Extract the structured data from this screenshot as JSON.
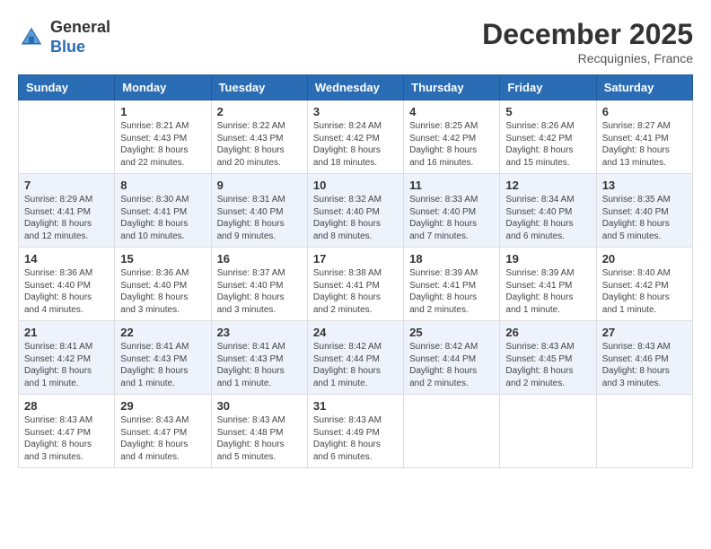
{
  "header": {
    "logo_general": "General",
    "logo_blue": "Blue",
    "month_title": "December 2025",
    "location": "Recquignies, France"
  },
  "calendar": {
    "days_of_week": [
      "Sunday",
      "Monday",
      "Tuesday",
      "Wednesday",
      "Thursday",
      "Friday",
      "Saturday"
    ],
    "weeks": [
      [
        {
          "day": "",
          "content": ""
        },
        {
          "day": "1",
          "content": "Sunrise: 8:21 AM\nSunset: 4:43 PM\nDaylight: 8 hours\nand 22 minutes."
        },
        {
          "day": "2",
          "content": "Sunrise: 8:22 AM\nSunset: 4:43 PM\nDaylight: 8 hours\nand 20 minutes."
        },
        {
          "day": "3",
          "content": "Sunrise: 8:24 AM\nSunset: 4:42 PM\nDaylight: 8 hours\nand 18 minutes."
        },
        {
          "day": "4",
          "content": "Sunrise: 8:25 AM\nSunset: 4:42 PM\nDaylight: 8 hours\nand 16 minutes."
        },
        {
          "day": "5",
          "content": "Sunrise: 8:26 AM\nSunset: 4:42 PM\nDaylight: 8 hours\nand 15 minutes."
        },
        {
          "day": "6",
          "content": "Sunrise: 8:27 AM\nSunset: 4:41 PM\nDaylight: 8 hours\nand 13 minutes."
        }
      ],
      [
        {
          "day": "7",
          "content": "Sunrise: 8:29 AM\nSunset: 4:41 PM\nDaylight: 8 hours\nand 12 minutes."
        },
        {
          "day": "8",
          "content": "Sunrise: 8:30 AM\nSunset: 4:41 PM\nDaylight: 8 hours\nand 10 minutes."
        },
        {
          "day": "9",
          "content": "Sunrise: 8:31 AM\nSunset: 4:40 PM\nDaylight: 8 hours\nand 9 minutes."
        },
        {
          "day": "10",
          "content": "Sunrise: 8:32 AM\nSunset: 4:40 PM\nDaylight: 8 hours\nand 8 minutes."
        },
        {
          "day": "11",
          "content": "Sunrise: 8:33 AM\nSunset: 4:40 PM\nDaylight: 8 hours\nand 7 minutes."
        },
        {
          "day": "12",
          "content": "Sunrise: 8:34 AM\nSunset: 4:40 PM\nDaylight: 8 hours\nand 6 minutes."
        },
        {
          "day": "13",
          "content": "Sunrise: 8:35 AM\nSunset: 4:40 PM\nDaylight: 8 hours\nand 5 minutes."
        }
      ],
      [
        {
          "day": "14",
          "content": "Sunrise: 8:36 AM\nSunset: 4:40 PM\nDaylight: 8 hours\nand 4 minutes."
        },
        {
          "day": "15",
          "content": "Sunrise: 8:36 AM\nSunset: 4:40 PM\nDaylight: 8 hours\nand 3 minutes."
        },
        {
          "day": "16",
          "content": "Sunrise: 8:37 AM\nSunset: 4:40 PM\nDaylight: 8 hours\nand 3 minutes."
        },
        {
          "day": "17",
          "content": "Sunrise: 8:38 AM\nSunset: 4:41 PM\nDaylight: 8 hours\nand 2 minutes."
        },
        {
          "day": "18",
          "content": "Sunrise: 8:39 AM\nSunset: 4:41 PM\nDaylight: 8 hours\nand 2 minutes."
        },
        {
          "day": "19",
          "content": "Sunrise: 8:39 AM\nSunset: 4:41 PM\nDaylight: 8 hours\nand 1 minute."
        },
        {
          "day": "20",
          "content": "Sunrise: 8:40 AM\nSunset: 4:42 PM\nDaylight: 8 hours\nand 1 minute."
        }
      ],
      [
        {
          "day": "21",
          "content": "Sunrise: 8:41 AM\nSunset: 4:42 PM\nDaylight: 8 hours\nand 1 minute."
        },
        {
          "day": "22",
          "content": "Sunrise: 8:41 AM\nSunset: 4:43 PM\nDaylight: 8 hours\nand 1 minute."
        },
        {
          "day": "23",
          "content": "Sunrise: 8:41 AM\nSunset: 4:43 PM\nDaylight: 8 hours\nand 1 minute."
        },
        {
          "day": "24",
          "content": "Sunrise: 8:42 AM\nSunset: 4:44 PM\nDaylight: 8 hours\nand 1 minute."
        },
        {
          "day": "25",
          "content": "Sunrise: 8:42 AM\nSunset: 4:44 PM\nDaylight: 8 hours\nand 2 minutes."
        },
        {
          "day": "26",
          "content": "Sunrise: 8:43 AM\nSunset: 4:45 PM\nDaylight: 8 hours\nand 2 minutes."
        },
        {
          "day": "27",
          "content": "Sunrise: 8:43 AM\nSunset: 4:46 PM\nDaylight: 8 hours\nand 3 minutes."
        }
      ],
      [
        {
          "day": "28",
          "content": "Sunrise: 8:43 AM\nSunset: 4:47 PM\nDaylight: 8 hours\nand 3 minutes."
        },
        {
          "day": "29",
          "content": "Sunrise: 8:43 AM\nSunset: 4:47 PM\nDaylight: 8 hours\nand 4 minutes."
        },
        {
          "day": "30",
          "content": "Sunrise: 8:43 AM\nSunset: 4:48 PM\nDaylight: 8 hours\nand 5 minutes."
        },
        {
          "day": "31",
          "content": "Sunrise: 8:43 AM\nSunset: 4:49 PM\nDaylight: 8 hours\nand 6 minutes."
        },
        {
          "day": "",
          "content": ""
        },
        {
          "day": "",
          "content": ""
        },
        {
          "day": "",
          "content": ""
        }
      ]
    ]
  }
}
